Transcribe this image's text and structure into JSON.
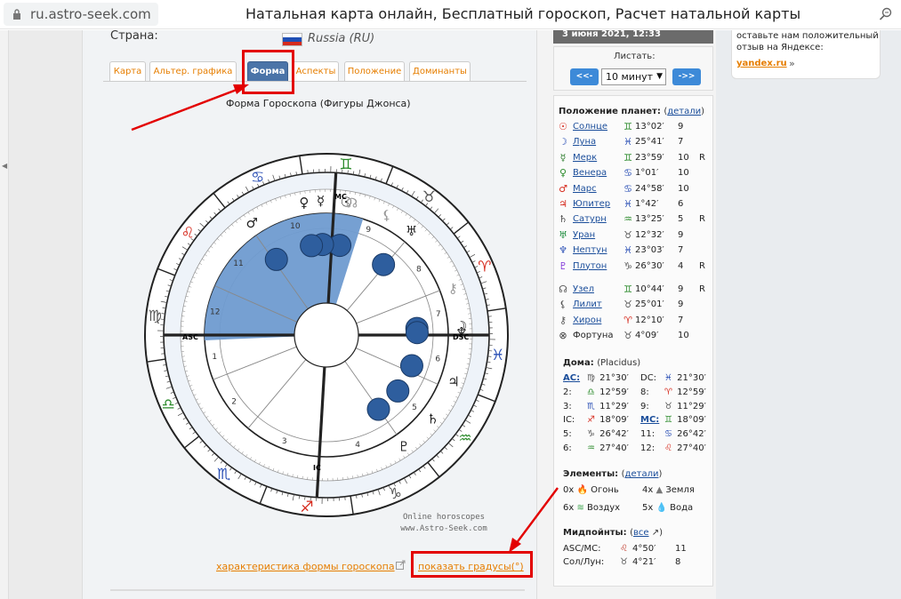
{
  "browser": {
    "address": "ru.astro-seek.com",
    "window_title": "Натальная карта онлайн, Бесплатный гороскоп, Расчет натальной карты"
  },
  "page": {
    "country_label": "Страна:",
    "country_value": "Russia (RU)"
  },
  "tabs": [
    {
      "label": "Карта"
    },
    {
      "label": "Альтер. графика"
    },
    {
      "label": "Форма"
    },
    {
      "label": "Аспекты"
    },
    {
      "label": "Положение"
    },
    {
      "label": "Доминанты"
    }
  ],
  "chart": {
    "title": "Форма Гороскопа (Фигуры Джонса)",
    "watermark_1": "Online horoscopes",
    "watermark_2": "www.Astro-Seek.com",
    "asc": "ASC",
    "mc": "MC",
    "dsc": "DSC",
    "ic": "IC",
    "house_numbers": [
      "1",
      "2",
      "3",
      "4",
      "5",
      "6",
      "7",
      "8",
      "9",
      "10",
      "11",
      "12"
    ]
  },
  "links": {
    "shape_characteristic": "характеристика формы гороскопа",
    "show_degrees": "показать градусы(°)"
  },
  "sidebar": {
    "date": "3 июня 2021, 12:33",
    "nav_label": "Листать:",
    "prev": "<<-",
    "next": "->>",
    "step": "10 минут",
    "planets_header": "Положение планет:",
    "details_link": "детали",
    "planets": [
      {
        "glyph": "☉",
        "name": "Солнце",
        "sign": "♊",
        "deg": "13°02′",
        "house": "9",
        "retro": ""
      },
      {
        "glyph": "☽",
        "name": "Луна",
        "sign": "♓",
        "deg": "25°41′",
        "house": "7",
        "retro": ""
      },
      {
        "glyph": "☿",
        "name": "Мерк",
        "sign": "♊",
        "deg": "23°59′",
        "house": "10",
        "retro": "R"
      },
      {
        "glyph": "♀",
        "name": "Венера",
        "sign": "♋",
        "deg": "1°01′",
        "house": "10",
        "retro": ""
      },
      {
        "glyph": "♂",
        "name": "Марс",
        "sign": "♋",
        "deg": "24°58′",
        "house": "10",
        "retro": ""
      },
      {
        "glyph": "♃",
        "name": "Юпитер",
        "sign": "♓",
        "deg": "1°42′",
        "house": "6",
        "retro": ""
      },
      {
        "glyph": "♄",
        "name": "Сатурн",
        "sign": "♒",
        "deg": "13°25′",
        "house": "5",
        "retro": "R"
      },
      {
        "glyph": "♅",
        "name": "Уран",
        "sign": "♉",
        "deg": "12°32′",
        "house": "9",
        "retro": ""
      },
      {
        "glyph": "♆",
        "name": "Нептун",
        "sign": "♓",
        "deg": "23°03′",
        "house": "7",
        "retro": ""
      },
      {
        "glyph": "♇",
        "name": "Плутон",
        "sign": "♑",
        "deg": "26°30′",
        "house": "4",
        "retro": "R"
      }
    ],
    "points": [
      {
        "glyph": "☊",
        "name": "Узел",
        "sign": "♊",
        "deg": "10°44′",
        "house": "9",
        "retro": "R"
      },
      {
        "glyph": "⚸",
        "name": "Лилит",
        "sign": "♉",
        "deg": "25°01′",
        "house": "9",
        "retro": ""
      },
      {
        "glyph": "⚷",
        "name": "Хирон",
        "sign": "♈",
        "deg": "12°10′",
        "house": "7",
        "retro": ""
      },
      {
        "glyph": "⊗",
        "name": "Фортуна",
        "sign": "♉",
        "deg": "4°09′",
        "house": "10",
        "retro": ""
      }
    ],
    "houses_header": "Дома:",
    "houses_system": "(Placidus)",
    "houses": [
      {
        "l": "AC:",
        "s": "♍",
        "d": "21°30′",
        "l2": "DC:",
        "s2": "♓",
        "d2": "21°30′"
      },
      {
        "l": "2:",
        "s": "♎",
        "d": "12°59′",
        "l2": "8:",
        "s2": "♈",
        "d2": "12°59′"
      },
      {
        "l": "3:",
        "s": "♏",
        "d": "11°29′",
        "l2": "9:",
        "s2": "♉",
        "d2": "11°29′"
      },
      {
        "l": "IC:",
        "s": "♐",
        "d": "18°09′",
        "l2": "MC:",
        "s2": "♊",
        "d2": "18°09′"
      },
      {
        "l": "5:",
        "s": "♑",
        "d": "26°42′",
        "l2": "11:",
        "s2": "♋",
        "d2": "26°42′"
      },
      {
        "l": "6:",
        "s": "♒",
        "d": "27°40′",
        "l2": "12:",
        "s2": "♌",
        "d2": "27°40′"
      }
    ],
    "elements_header": "Элементы:",
    "elements": [
      {
        "count": "0x",
        "name": "Огонь"
      },
      {
        "count": "4x",
        "name": "Земля"
      },
      {
        "count": "6x",
        "name": "Воздух"
      },
      {
        "count": "5x",
        "name": "Вода"
      }
    ],
    "midpoints_header": "Мидпойнты:",
    "midpoints_link": "все",
    "midpoints": [
      {
        "label": "ASC/MC:",
        "sign": "♌",
        "deg": "4°50′",
        "house": "11"
      },
      {
        "label": "Сол/Лун:",
        "sign": "♉",
        "deg": "4°21′",
        "house": "8"
      }
    ]
  },
  "ad": {
    "text": "оставьте нам положительный отзыв на Яндексе:",
    "link": "yandex.ru",
    "raquo": "»"
  }
}
